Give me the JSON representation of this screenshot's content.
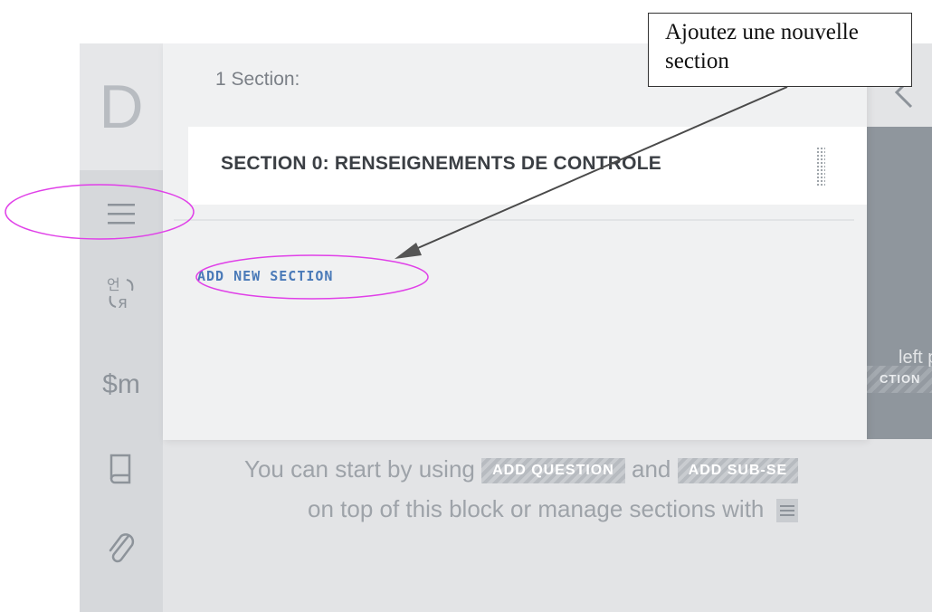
{
  "app": {
    "logo_letter": "D",
    "rail": {
      "items": [
        {
          "name": "menu-icon"
        },
        {
          "name": "translate-icon"
        },
        {
          "name": "currency-macro-icon",
          "label": "$m"
        },
        {
          "name": "book-icon"
        },
        {
          "name": "paperclip-icon"
        }
      ]
    }
  },
  "panel": {
    "count_label": "1 Section:",
    "sections": [
      {
        "title": "SECTION 0: RENSEIGNEMENTS DE CONTROLE"
      }
    ],
    "add_section_label": "ADD NEW SECTION"
  },
  "background": {
    "stripe_label": "CTION",
    "left_panel_fragment": "left pa",
    "help_line1_prefix": "You can start by using",
    "add_question_label": "ADD QUESTION",
    "help_and": "and",
    "add_subsection_label": "ADD SUB-SE",
    "help_line2": "on top of this block or manage sections with"
  },
  "callout": {
    "text_line1": "Ajoutez une nouvelle",
    "text_line2": "section"
  },
  "colors": {
    "annotation_ellipse": "#e040e8",
    "link_blue": "#4a7ab8",
    "rail_bg": "#d6d8db"
  }
}
